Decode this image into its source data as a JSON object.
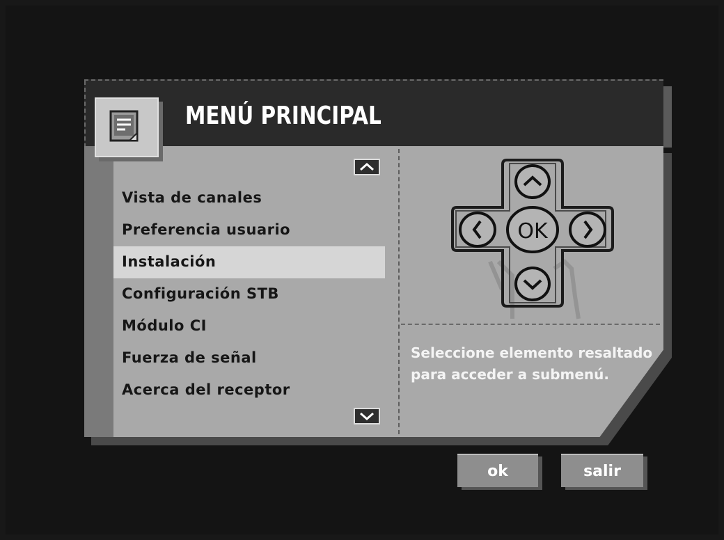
{
  "header": {
    "title": "MENÚ PRINCIPAL",
    "icon": "menu-document-icon"
  },
  "menu": {
    "items": [
      {
        "label": "Vista de canales"
      },
      {
        "label": "Preferencia usuario"
      },
      {
        "label": "Instalación"
      },
      {
        "label": "Configuración STB"
      },
      {
        "label": "Módulo CI"
      },
      {
        "label": "Fuerza de señal"
      },
      {
        "label": "Acerca del receptor"
      }
    ],
    "selected_index": 2
  },
  "dpad": {
    "center_label": "OK"
  },
  "help": {
    "text": "Seleccione elemento resaltado para acceder a submenú."
  },
  "buttons": {
    "ok_label": "ok",
    "exit_label": "salir"
  },
  "colors": {
    "background": "#141414",
    "panel": "#a9a9a9",
    "header": "#2a2a2a",
    "highlight": "#d6d6d6",
    "button": "#8e8e8e"
  }
}
